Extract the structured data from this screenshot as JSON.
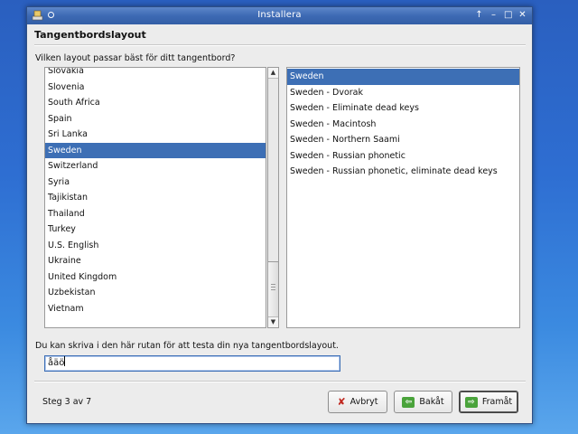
{
  "window": {
    "title": "Installera"
  },
  "page": {
    "heading": "Tangentbordslayout",
    "prompt": "Vilken layout passar bäst för ditt tangentbord?"
  },
  "countries": [
    "Slovakia",
    "Slovenia",
    "South Africa",
    "Spain",
    "Sri Lanka",
    "Sweden",
    "Switzerland",
    "Syria",
    "Tajikistan",
    "Thailand",
    "Turkey",
    "U.S. English",
    "Ukraine",
    "United Kingdom",
    "Uzbekistan",
    "Vietnam"
  ],
  "selected_country": "Sweden",
  "variants": [
    "Sweden",
    "Sweden - Dvorak",
    "Sweden - Eliminate dead keys",
    "Sweden - Macintosh",
    "Sweden - Northern Saami",
    "Sweden - Russian phonetic",
    "Sweden - Russian phonetic, eliminate dead keys"
  ],
  "selected_variant": "Sweden",
  "test": {
    "label": "Du kan skriva i den här rutan för att testa din nya tangentbordslayout.",
    "value": "åäö"
  },
  "footer": {
    "step": "Steg 3 av 7",
    "cancel": "Avbryt",
    "back": "Bakåt",
    "forward": "Framåt"
  },
  "colors": {
    "selection": "#3d6fb5",
    "titlebar": "#3d6ab4"
  },
  "icons": {
    "app": "installer-icon",
    "cancel": "x-icon",
    "back": "green-arrow-left-icon",
    "forward": "green-arrow-right-icon"
  }
}
